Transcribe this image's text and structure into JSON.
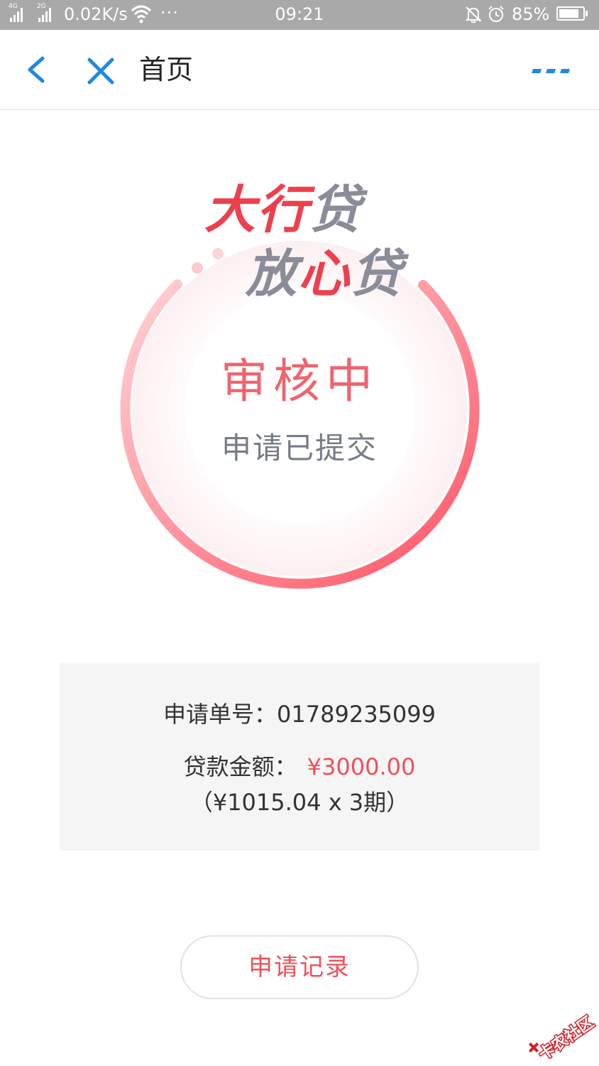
{
  "status_bar": {
    "network1": "4G",
    "network2": "2G",
    "speed": "0.02K/s",
    "more": "···",
    "time": "09:21",
    "battery_percent": "85%",
    "battery_level": 0.85
  },
  "nav": {
    "title": "首页",
    "accent_color": "#1e88e5"
  },
  "hero": {
    "brand_line1": [
      "大行",
      "贷"
    ],
    "brand_line2": [
      "放",
      "心",
      "贷"
    ],
    "status": "审核中",
    "substatus": "申请已提交",
    "colors": {
      "red": "#ee3f4d",
      "gray": "#8a8c98",
      "ring_start": "#ffd3d6",
      "ring_end": "#ff5364"
    }
  },
  "application": {
    "order_label": "申请单号：",
    "order_number": "01789235099",
    "amount_label": "贷款金额：",
    "amount": "¥3000.00",
    "installment": "（¥1015.04 x 3期）"
  },
  "actions": {
    "records_label": "申请记录"
  },
  "watermark": {
    "text": "卡农社区"
  }
}
